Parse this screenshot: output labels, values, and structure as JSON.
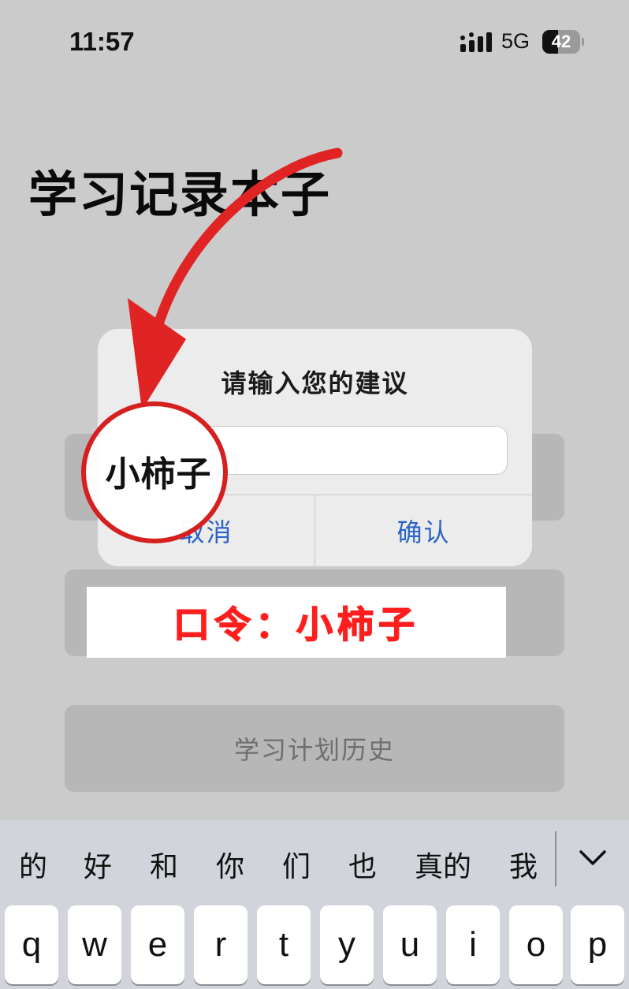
{
  "status_bar": {
    "time": "11:57",
    "network": "5G",
    "battery": "42",
    "battery_level": 0.42
  },
  "page": {
    "title": "学习记录本子",
    "buttons": [
      "",
      "",
      "学习计划历史"
    ]
  },
  "dialog": {
    "title": "请输入您的建议",
    "input_value": "",
    "cancel_label": "取消",
    "confirm_label": "确认"
  },
  "annotation": {
    "circle_text": "小柿子",
    "banner_text": "口令：小柿子",
    "color": "#d62020"
  },
  "keyboard": {
    "candidates": [
      "的",
      "好",
      "和",
      "你",
      "们",
      "也",
      "真的",
      "我"
    ],
    "keys": [
      "q",
      "w",
      "e",
      "r",
      "t",
      "y",
      "u",
      "i",
      "o",
      "p"
    ]
  },
  "colors": {
    "background": "#cbcbcb",
    "accent_blue": "#2a63c8",
    "annotation_red": "#ff1e1e"
  }
}
